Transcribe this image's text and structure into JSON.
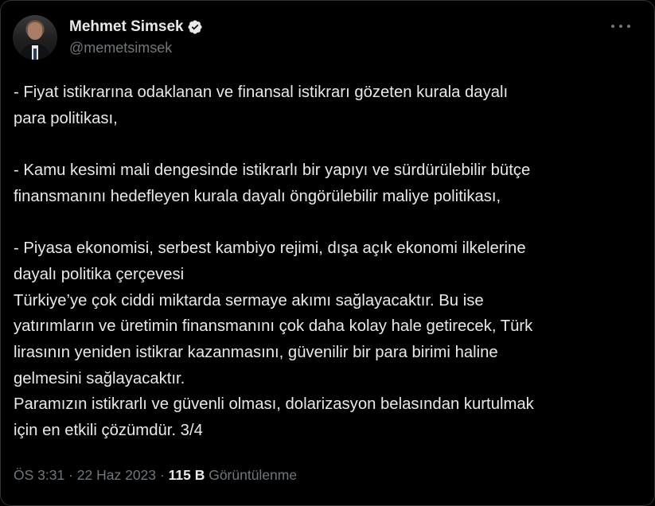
{
  "author": {
    "display_name": "Mehmet Simsek",
    "handle": "@memetsimsek",
    "verified_icon": "verified-badge-icon",
    "accent_color": "#1d9bf0"
  },
  "more_icon": "ellipsis-icon",
  "tweet": {
    "lines": [
      "- Fiyat istikrarına odaklanan ve finansal istikrarı gözeten kurala dayalı",
      "para politikası,",
      "",
      "- Kamu kesimi mali dengesinde istikrarlı bir yapıyı ve sürdürülebilir bütçe",
      "finansmanını hedefleyen kurala dayalı öngörülebilir maliye politikası,",
      "",
      "- Piyasa ekonomisi, serbest kambiyo rejimi, dışa açık ekonomi ilkelerine",
      "dayalı politika çerçevesi",
      "Türkiye’ye çok ciddi miktarda sermaye akımı sağlayacaktır. Bu ise",
      "yatırımların ve üretimin finansmanını çok daha kolay hale getirecek, Türk",
      "lirasının yeniden istikrar kazanmasını, güvenilir bir para birimi haline",
      "gelmesini sağlayacaktır.",
      "Paramızın istikrarlı ve güvenli olması, dolarizasyon belasından kurtulmak",
      "için en etkili çözümdür. 3/4"
    ]
  },
  "meta": {
    "time": "ÖS 3:31",
    "separator": " · ",
    "date": "22 Haz 2023",
    "views_count": "115 B",
    "views_label": "Görüntülenme"
  }
}
